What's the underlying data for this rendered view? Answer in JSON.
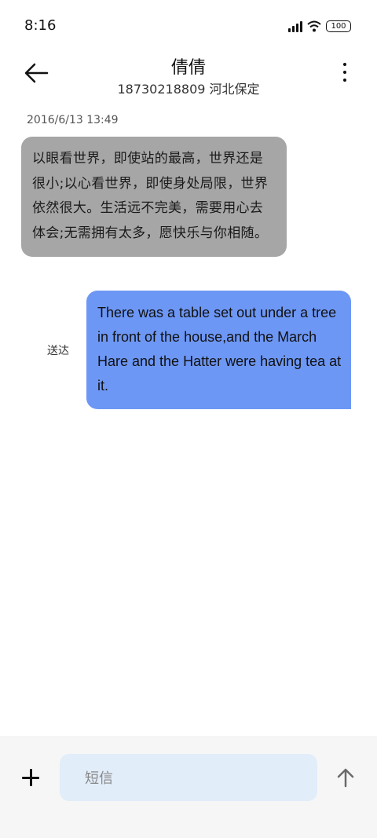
{
  "status_bar": {
    "time": "8:16",
    "battery": "100"
  },
  "header": {
    "contact_name": "倩倩",
    "contact_info": "18730218809 河北保定"
  },
  "conversation": {
    "timestamp": "2016/6/13 13:49",
    "received_message": "以眼看世界，即使站的最高，世界还是很小;以心看世界，即使身处局限，世界依然很大。生活远不完美，需要用心去体会;无需拥有太多，愿快乐与你相随。",
    "sent_message": "There was a table set out under a tree in front of the house,and the March Hare and the Hatter were having tea at it.",
    "sent_status": "送达"
  },
  "composer": {
    "placeholder": "短信"
  },
  "colors": {
    "received_bubble": "#a7a6a6",
    "sent_bubble": "#6d97f5",
    "input_background": "#e2edfa"
  }
}
